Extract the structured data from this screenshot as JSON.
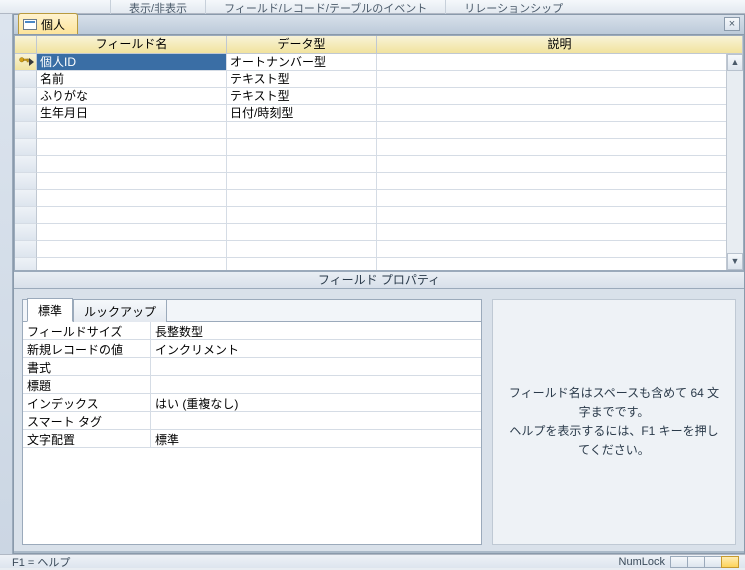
{
  "ribbon": {
    "show_hide": "表示/非表示",
    "events": "フィールド/レコード/テーブルのイベント",
    "relationships": "リレーションシップ"
  },
  "tab": {
    "title": "個人"
  },
  "grid": {
    "headers": {
      "field_name": "フィールド名",
      "data_type": "データ型",
      "description": "説明"
    },
    "rows": [
      {
        "pk": true,
        "selected": true,
        "field_name": "個人ID",
        "data_type": "オートナンバー型",
        "description": ""
      },
      {
        "pk": false,
        "selected": false,
        "field_name": "名前",
        "data_type": "テキスト型",
        "description": ""
      },
      {
        "pk": false,
        "selected": false,
        "field_name": "ふりがな",
        "data_type": "テキスト型",
        "description": ""
      },
      {
        "pk": false,
        "selected": false,
        "field_name": "生年月日",
        "data_type": "日付/時刻型",
        "description": ""
      }
    ],
    "empty_rows": 11
  },
  "properties": {
    "pane_title": "フィールド プロパティ",
    "tabs": {
      "general": "標準",
      "lookup": "ルックアップ"
    },
    "active_tab": "general",
    "rows": [
      {
        "label": "フィールドサイズ",
        "value": "長整数型"
      },
      {
        "label": "新規レコードの値",
        "value": "インクリメント"
      },
      {
        "label": "書式",
        "value": ""
      },
      {
        "label": "標題",
        "value": ""
      },
      {
        "label": "インデックス",
        "value": "はい (重複なし)"
      },
      {
        "label": "スマート タグ",
        "value": ""
      },
      {
        "label": "文字配置",
        "value": "標準"
      }
    ],
    "help_text_line1": "フィールド名はスペースも含めて 64 文字までです。",
    "help_text_line2": "ヘルプを表示するには、F1 キーを押してください。"
  },
  "status": {
    "left": "F1 = ヘルプ",
    "numlock": "NumLock"
  }
}
